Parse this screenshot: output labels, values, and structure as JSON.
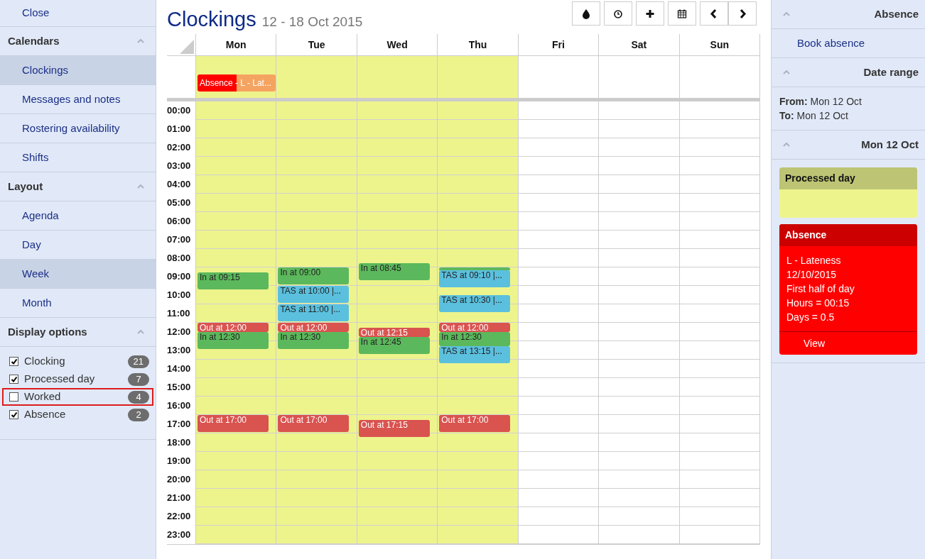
{
  "sidebar": {
    "close": "Close",
    "sections": [
      {
        "title": "Calendars",
        "expanded": true,
        "items": [
          {
            "label": "Clockings",
            "selected": true
          },
          {
            "label": "Messages and notes",
            "selected": false
          },
          {
            "label": "Rostering availability",
            "selected": false
          },
          {
            "label": "Shifts",
            "selected": false
          }
        ]
      },
      {
        "title": "Layout",
        "expanded": true,
        "items": [
          {
            "label": "Agenda",
            "selected": false
          },
          {
            "label": "Day",
            "selected": false
          },
          {
            "label": "Week",
            "selected": true
          },
          {
            "label": "Month",
            "selected": false
          }
        ]
      },
      {
        "title": "Display options",
        "expanded": true,
        "options": [
          {
            "label": "Clocking",
            "checked": true,
            "count": "21",
            "highlighted": false
          },
          {
            "label": "Processed day",
            "checked": true,
            "count": "7",
            "highlighted": false
          },
          {
            "label": "Worked",
            "checked": false,
            "count": "4",
            "highlighted": true
          },
          {
            "label": "Absence",
            "checked": true,
            "count": "2",
            "highlighted": false
          }
        ]
      }
    ]
  },
  "header": {
    "title": "Clockings",
    "range": "12 - 18 Oct 2015"
  },
  "toolbar": [
    {
      "kind": "drop"
    },
    {
      "kind": "clock"
    },
    {
      "kind": "plus"
    },
    {
      "kind": "calendar"
    },
    {
      "kind": "prev"
    },
    {
      "kind": "next"
    }
  ],
  "calendar": {
    "hours": [
      "00:00",
      "01:00",
      "02:00",
      "03:00",
      "04:00",
      "05:00",
      "06:00",
      "07:00",
      "08:00",
      "09:00",
      "10:00",
      "11:00",
      "12:00",
      "13:00",
      "14:00",
      "15:00",
      "16:00",
      "17:00",
      "18:00",
      "19:00",
      "20:00",
      "21:00",
      "22:00",
      "23:00"
    ],
    "days": [
      {
        "label": "Mon",
        "processed": true,
        "all_day": [
          {
            "label": "Absence - L - Lat..."
          }
        ],
        "events": [
          {
            "kind": "in",
            "label": "In at 09:15"
          },
          {
            "kind": "out",
            "label": "Out at 12:00"
          },
          {
            "kind": "in",
            "label": "In at 12:30"
          },
          {
            "kind": "out",
            "label": "Out at 17:00"
          }
        ]
      },
      {
        "label": "Tue",
        "processed": true,
        "events": [
          {
            "kind": "in",
            "label": "In at 09:00"
          },
          {
            "kind": "tas",
            "label": "TAS at 10:00 |..."
          },
          {
            "kind": "tas",
            "label": "TAS at 11:00 |..."
          },
          {
            "kind": "out",
            "label": "Out at 12:00"
          },
          {
            "kind": "in",
            "label": "In at 12:30"
          },
          {
            "kind": "out",
            "label": "Out at 17:00"
          }
        ]
      },
      {
        "label": "Wed",
        "processed": true,
        "events": [
          {
            "kind": "in",
            "label": "In at 08:45"
          },
          {
            "kind": "out",
            "label": "Out at 12:15"
          },
          {
            "kind": "in",
            "label": "In at 12:45"
          },
          {
            "kind": "out",
            "label": "Out at 17:15"
          }
        ]
      },
      {
        "label": "Thu",
        "processed": true,
        "events": [
          {
            "kind": "tas",
            "label": "TAS at 09:10 |...",
            "over_in": true
          },
          {
            "kind": "tas",
            "label": "TAS at 10:30 |..."
          },
          {
            "kind": "out",
            "label": "Out at 12:00"
          },
          {
            "kind": "in",
            "label": "In at 12:30"
          },
          {
            "kind": "tas",
            "label": "TAS at 13:15 |..."
          },
          {
            "kind": "out",
            "label": "Out at 17:00"
          }
        ]
      },
      {
        "label": "Fri",
        "processed": false
      },
      {
        "label": "Sat",
        "processed": false
      },
      {
        "label": "Sun",
        "processed": false
      }
    ]
  },
  "right_panel": {
    "absence": {
      "title": "Absence",
      "expanded": true,
      "link": "Book absence"
    },
    "date_range": {
      "title": "Date range",
      "expanded": true,
      "from": "**From:** Mon 12 Oct",
      "to": "**To:** Mon 12 Oct"
    },
    "day": {
      "title": "Mon 12 Oct",
      "expanded": true,
      "cards": [
        {
          "kind": "processed",
          "title": "Processed day"
        },
        {
          "kind": "absence",
          "title": "Absence",
          "lines": [
            "L - Lateness",
            "12/10/2015",
            "First half of day",
            "Hours = 00:15",
            "Days = 0.5"
          ],
          "action": "View"
        }
      ]
    }
  }
}
